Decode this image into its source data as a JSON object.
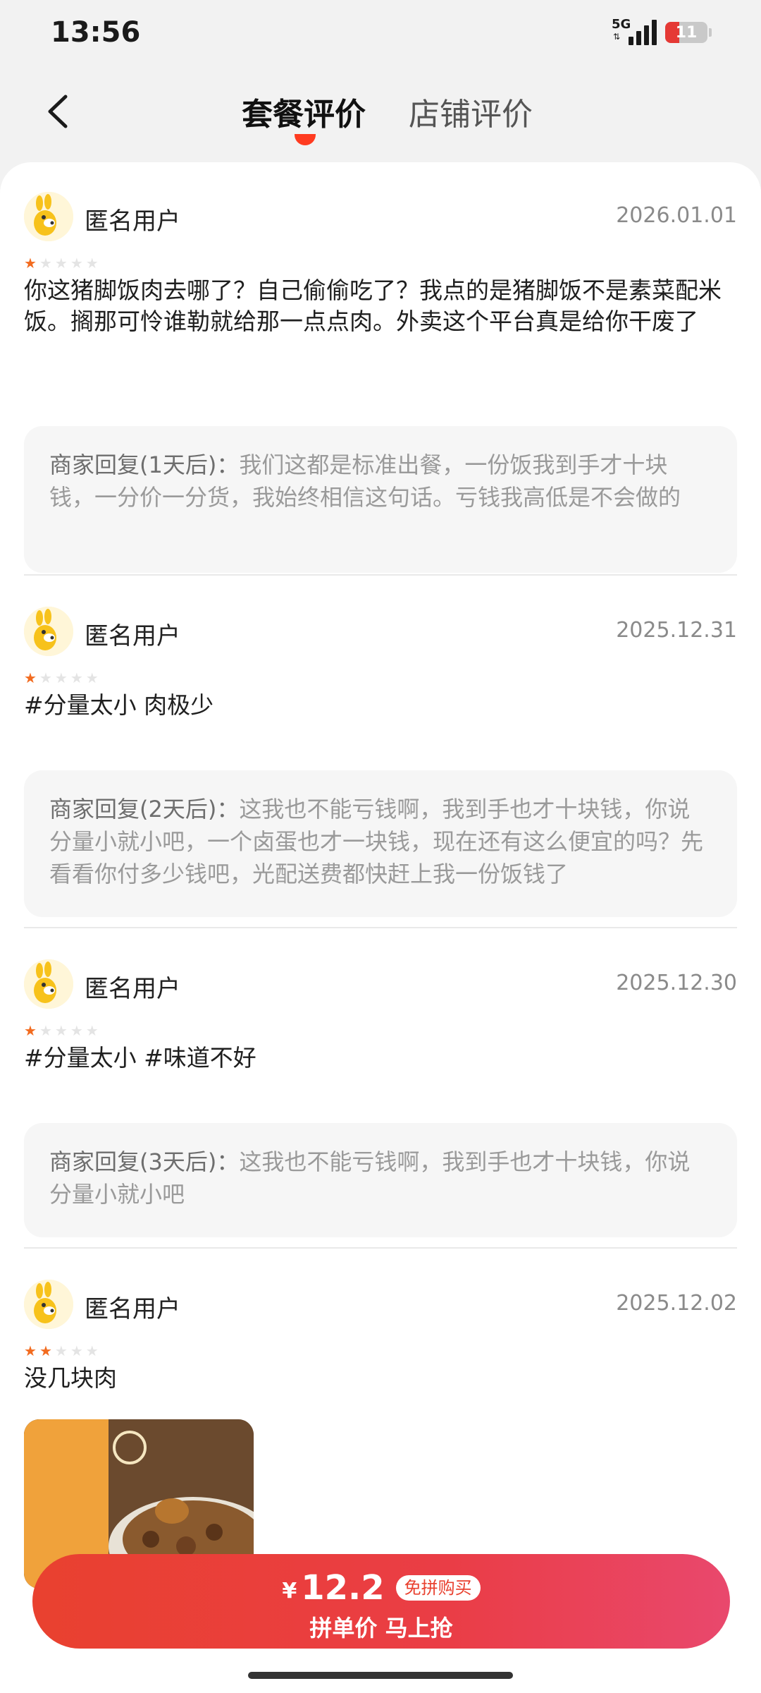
{
  "status_bar": {
    "time": "13:56",
    "network": "5G",
    "battery": "11"
  },
  "header": {
    "back_icon": "chevron-left-icon",
    "tabs": [
      {
        "label": "套餐评价",
        "active": true
      },
      {
        "label": "店铺评价",
        "active": false
      }
    ],
    "accent_color": "#ff3b20"
  },
  "reviews": [
    {
      "user": "匿名用户",
      "date": "2026.01.01",
      "rating": 1,
      "text": "你这猪脚饭肉去哪了？自己偷偷吃了？我点的是猪脚饭不是素菜配米饭。搁那可怜谁勒就给那一点点肉。外卖这个平台真是给你干废了",
      "reply_label": "商家回复(1天后)：",
      "reply_text": "我们这都是标准出餐，一份饭我到手才十块钱，一分价一分货，我始终相信这句话。亏钱我高低是不会做的"
    },
    {
      "user": "匿名用户",
      "date": "2025.12.31",
      "rating": 1,
      "text": "#分量太小 肉极少",
      "reply_label": "商家回复(2天后)：",
      "reply_text": "这我也不能亏钱啊，我到手也才十块钱，你说分量小就小吧，一个卤蛋也才一块钱，现在还有这么便宜的吗？先看看你付多少钱吧，光配送费都快赶上我一份饭钱了"
    },
    {
      "user": "匿名用户",
      "date": "2025.12.30",
      "rating": 1,
      "text": "#分量太小 #味道不好",
      "reply_label": "商家回复(3天后)：",
      "reply_text": "这我也不能亏钱啊，我到手也才十块钱，你说分量小就小吧"
    },
    {
      "user": "匿名用户",
      "date": "2025.12.02",
      "rating": 2,
      "text": "没几块肉"
    }
  ],
  "bottom_bar": {
    "currency": "¥",
    "price": "12.2",
    "badge": "免拼购买",
    "subtitle": "拼单价 马上抢",
    "gradient_start": "#e9412f",
    "gradient_end": "#e9486d"
  }
}
